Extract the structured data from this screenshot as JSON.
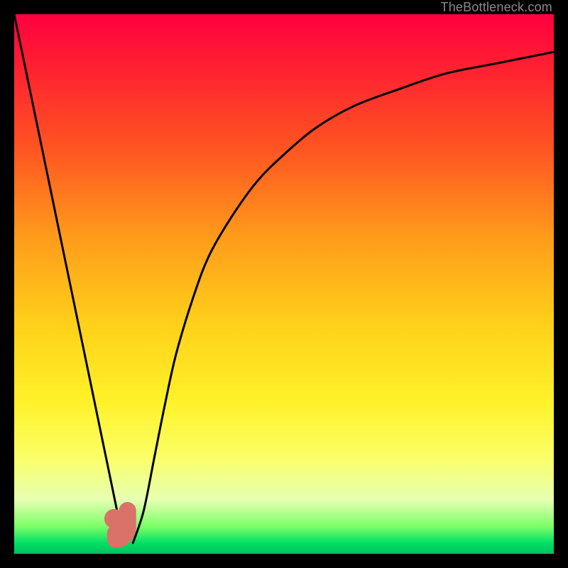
{
  "watermark": "TheBottleneck.com",
  "chart_data": {
    "type": "line",
    "title": "",
    "xlabel": "",
    "ylabel": "",
    "xlim": [
      0,
      100
    ],
    "ylim": [
      0,
      100
    ],
    "grid": false,
    "legend": false,
    "series": [
      {
        "name": "left-branch",
        "x": [
          0,
          20.3
        ],
        "values": [
          100,
          2
        ]
      },
      {
        "name": "right-branch",
        "x": [
          22,
          24,
          26,
          28,
          30,
          33,
          36,
          40,
          45,
          50,
          56,
          63,
          71,
          80,
          90,
          100
        ],
        "values": [
          2,
          8,
          18,
          28,
          37,
          47,
          55,
          62,
          69,
          74,
          79,
          83,
          86,
          89,
          91,
          93
        ]
      }
    ],
    "markers": [
      {
        "name": "marker-dot",
        "x": 18.5,
        "y": 6.5,
        "r": 1.8,
        "color": "#D97368"
      },
      {
        "name": "marker-j-stroke",
        "x_start": 21.0,
        "y_start": 8.0,
        "x_end": 21.0,
        "y_end": 2.5,
        "hook_x": 18.8,
        "hook_y": 2.5,
        "width": 3.2,
        "color": "#D97368"
      }
    ],
    "background_gradient": {
      "stops": [
        {
          "pos": 0.0,
          "color": "#ff0040"
        },
        {
          "pos": 0.5,
          "color": "#ffcc1a"
        },
        {
          "pos": 0.95,
          "color": "#7aff66"
        },
        {
          "pos": 1.0,
          "color": "#00c060"
        }
      ]
    }
  }
}
